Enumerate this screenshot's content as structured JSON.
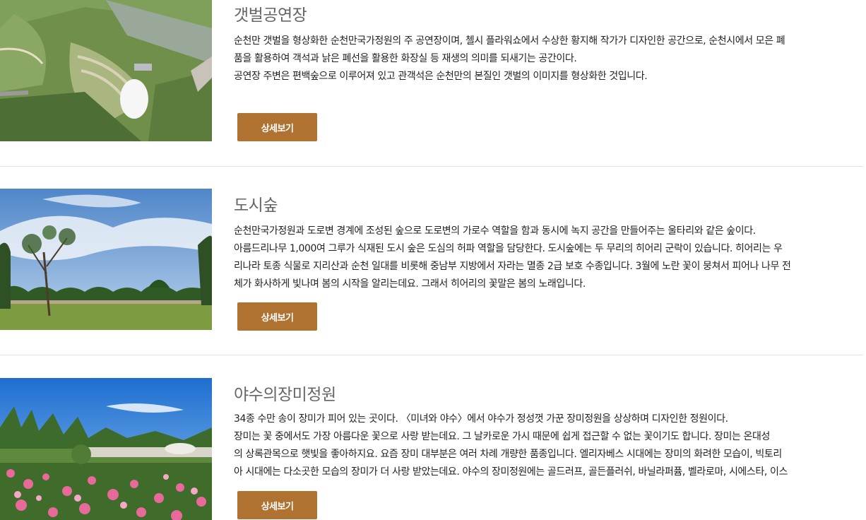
{
  "items": [
    {
      "title": "갯벌공연장",
      "lines": [
        "순천만 갯벌을 형상화한 순천만국가정원의 주 공연장이며, 첼시 플라워쇼에서 수상한 황지해 작가가 디자인한 공간으로, 순천시에서 모은 폐",
        "품을 활용하여 객석과 낡은 폐선을 활용한 화장실 등 재생의 의미를 되새기는 공간이다.",
        " 공연장 주변은 편백숲으로 이루어져 있고 관객석은 순천만의 본질인 갯벌의 이미지를 형상화한 것입니다."
      ],
      "button_label": "상세보기"
    },
    {
      "title": "도시숲",
      "lines": [
        "순천만국가정원과 도로변 경계에 조성된 숲으로 도로변의 가로수 역할을 함과 동시에 녹지 공간을 만들어주는 울타리와 같은 숲이다.",
        " 아름드리나무 1,000여 그루가 식재된 도시 숲은 도심의 허파 역할을 담당한다. 도시숲에는 두 무리의 히어리 군락이 있습니다. 히어리는 우",
        "리나라 토종 식물로 지리산과 순천 일대를 비롯해 중남부 지방에서 자라는 멸종 2급 보호 수종입니다. 3월에 노란 꽃이 뭉쳐서 피어나 나무 전",
        "체가 화사하게 빛나며 봄의 시작을 알리는데요. 그래서 히어리의 꽃말은 봄의 노래입니다."
      ],
      "button_label": "상세보기"
    },
    {
      "title": "야수의장미정원",
      "lines": [
        "34종 수만 송이 장미가 피어 있는 곳이다. 〈미녀와 야수〉에서 야수가 정성껏 가꾼 장미정원을 상상하며 디자인한 정원이다.",
        " 장미는 꽃 중에서도 가장 아름다운 꽃으로 사랑 받는데요. 그 날카로운 가시 때문에 쉽게 접근할 수 없는 꽃이기도 합니다. 장미는 온대성",
        "의 상록관목으로 햇빛을 좋아하지요. 요즘 장미 대부분은 여러 차례 개량한 품종입니다. 엘리자베스 시대에는 장미의 화려한 모습이, 빅토리",
        "아 시대에는 다소곳한 모습의 장미가 더 사랑 받았는데요. 야수의 장미정원에는 골드러프, 골든플러쉬, 바닐라퍼퓸, 벨라로마, 시에스타, 이스"
      ],
      "button_label": "상세보기"
    }
  ],
  "colors": {
    "button": "#b07230",
    "title": "#666666",
    "divider": "#e3e3e3"
  }
}
